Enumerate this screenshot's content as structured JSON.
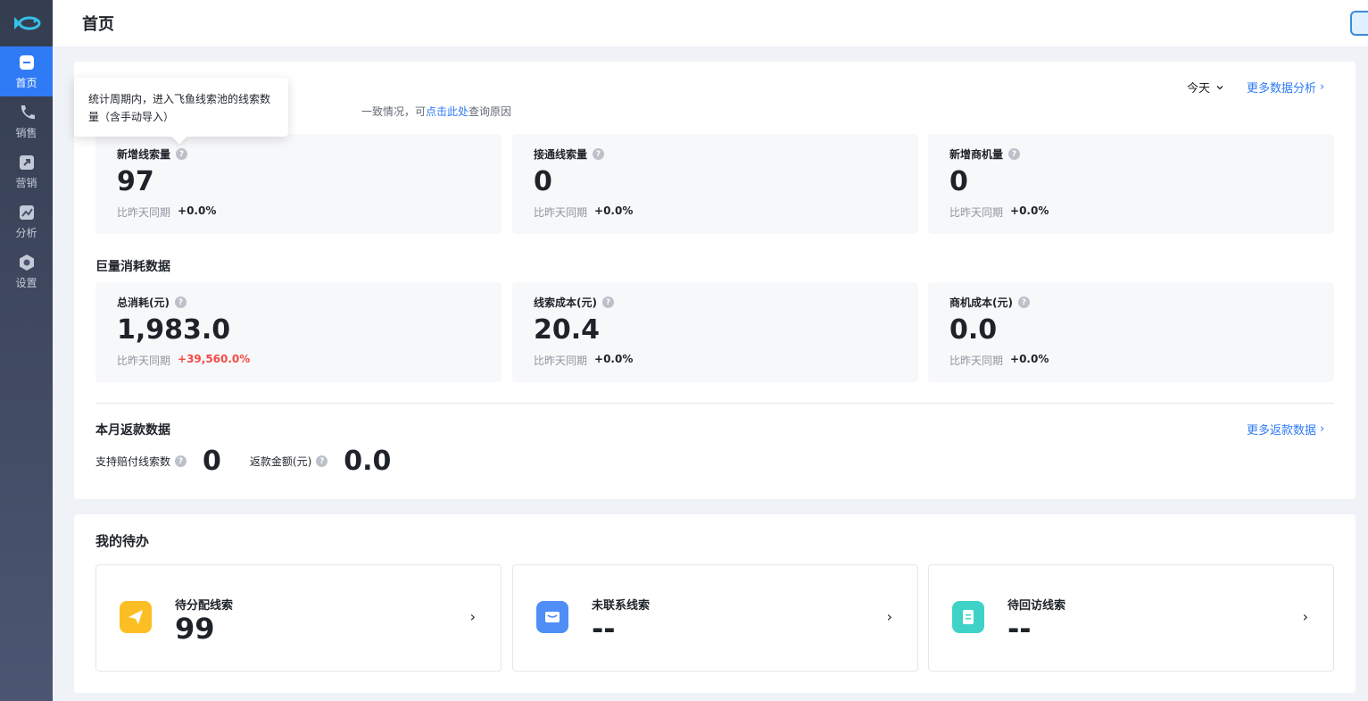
{
  "nav": {
    "items": [
      {
        "label": "首页",
        "icon": "home-icon"
      },
      {
        "label": "销售",
        "icon": "phone-icon"
      },
      {
        "label": "营销",
        "icon": "marketing-icon"
      },
      {
        "label": "分析",
        "icon": "analysis-icon"
      },
      {
        "label": "设置",
        "icon": "settings-icon"
      }
    ]
  },
  "header": {
    "title": "首页"
  },
  "overview": {
    "tip_text": "一致情况，可",
    "tip_link": "点击此处",
    "tip_tail": "查询原因",
    "range": "今天",
    "more_link": "更多数据分析",
    "stats": [
      {
        "label": "新增线索量",
        "value": "97",
        "compare_label": "比昨天同期",
        "change": "+0.0%"
      },
      {
        "label": "接通线索量",
        "value": "0",
        "compare_label": "比昨天同期",
        "change": "+0.0%"
      },
      {
        "label": "新增商机量",
        "value": "0",
        "compare_label": "比昨天同期",
        "change": "+0.0%"
      }
    ]
  },
  "tooltip": {
    "text": "统计周期内，进入飞鱼线索池的线索数量（含手动导入）"
  },
  "consumption": {
    "title": "巨量消耗数据",
    "stats": [
      {
        "label": "总消耗(元)",
        "value": "1,983.0",
        "compare_label": "比昨天同期",
        "change": "+39,560.0%"
      },
      {
        "label": "线索成本(元)",
        "value": "20.4",
        "compare_label": "比昨天同期",
        "change": "+0.0%"
      },
      {
        "label": "商机成本(元)",
        "value": "0.0",
        "compare_label": "比昨天同期",
        "change": "+0.0%"
      }
    ]
  },
  "refund": {
    "title": "本月返款数据",
    "more_link": "更多返款数据",
    "items": [
      {
        "label": "支持赔付线索数",
        "value": "0"
      },
      {
        "label": "返款金额(元)",
        "value": "0.0"
      }
    ]
  },
  "todo": {
    "title": "我的待办",
    "items": [
      {
        "label": "待分配线索",
        "value": "99",
        "icon": "send-icon",
        "color": "#fbbf24"
      },
      {
        "label": "未联系线索",
        "value": "--",
        "icon": "message-icon",
        "color": "#4f8ef7"
      },
      {
        "label": "待回访线索",
        "value": "--",
        "icon": "document-icon",
        "color": "#3ed3c6"
      }
    ]
  },
  "colors": {
    "accent": "#2f7bf6",
    "increase": "#f54a45"
  }
}
